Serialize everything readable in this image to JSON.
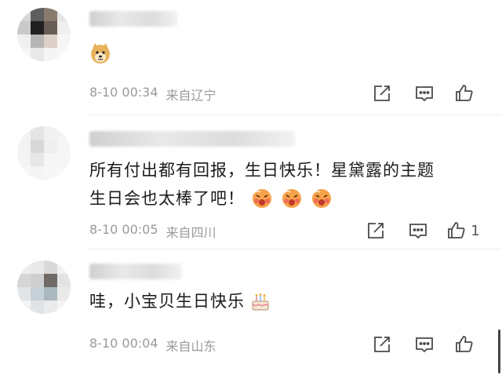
{
  "comments": [
    {
      "avatar_colors": [
        "#d7d7d7",
        "#5e5e5e",
        "#8a7b6f",
        "#e6e6e6",
        "#c9c9c9",
        "#202020",
        "#6a5e58",
        "#efefef",
        "#f0f0f0",
        "#b5b5b5",
        "#ddd0c6",
        "#f5f5f5",
        "#f5f5f5",
        "#e8e8e8",
        "#f5f5f5",
        "#f8f8f8"
      ],
      "emoji": "doge-emoji",
      "text": "",
      "time": "8-10 00:34",
      "location": "来自辽宁",
      "like_count": ""
    },
    {
      "avatar_colors": [
        "#f3f3f3",
        "#e5e5e5",
        "#f1f1f1",
        "#f3f3f3",
        "#f3f3f3",
        "#d8d8d8",
        "#efefef",
        "#f5f5f5",
        "#f4f4f4",
        "#e7e7e7",
        "#f5f5f5",
        "#f6f6f6",
        "#f6f6f6",
        "#f4f4f4",
        "#f7f7f7",
        "#f8f8f8"
      ],
      "text_line1": "所有付出都有回报，生日快乐！星黛露的主题",
      "text_line2": "生日会也太棒了吧！",
      "emoji": "hot-face-emoji",
      "time": "8-10 00:05",
      "location": "来自四川",
      "like_count": "1"
    },
    {
      "avatar_colors": [
        "#ececec",
        "#e9e9e9",
        "#d9d9d9",
        "#f1f1f1",
        "#d5d5d5",
        "#cfcfcf",
        "#6f6a66",
        "#e3e3e3",
        "#e2e5e8",
        "#c6d1d7",
        "#a9b7be",
        "#eaeaea",
        "#f3f3f3",
        "#dfe3e5",
        "#e9ebec",
        "#f5f5f5"
      ],
      "text": "哇，小宝贝生日快乐",
      "emoji": "cake-emoji",
      "time": "8-10 00:04",
      "location": "来自山东",
      "like_count": ""
    }
  ],
  "icons": {
    "share": "share-icon",
    "comment": "comment-icon",
    "like": "like-icon"
  },
  "colors": {
    "meta": "#9a9a9a",
    "text": "#1a1a1a",
    "icon": "#4a4a4a"
  }
}
